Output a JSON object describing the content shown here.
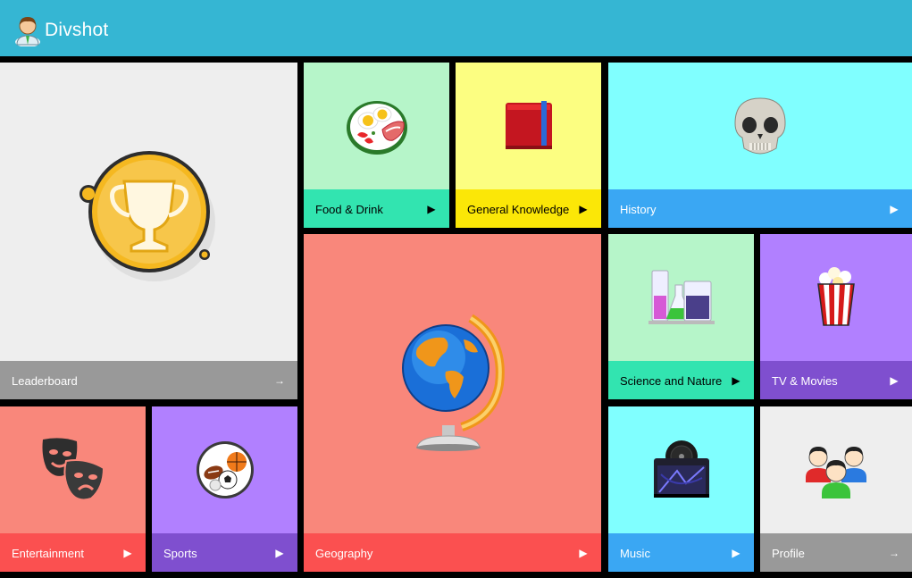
{
  "header": {
    "brand": "Divshot",
    "bg": "#35b6d3"
  },
  "tiles": {
    "leaderboard": {
      "label": "Leaderboard",
      "icon": "trophy-icon",
      "arrow": "→",
      "bg": "#eeeeee",
      "bar": "#999999"
    },
    "food": {
      "label": "Food & Drink",
      "icon": "food-plate-icon",
      "arrow": "▶",
      "bg": "#b6f5c9",
      "bar": "#32e4b0"
    },
    "general": {
      "label": "General Knowledge",
      "icon": "book-icon",
      "arrow": "▶",
      "bg": "#fcfe81",
      "bar": "#fbe707"
    },
    "history": {
      "label": "History",
      "icon": "skull-icon",
      "arrow": "▶",
      "bg": "#80ffff",
      "bar": "#3aa7f3"
    },
    "geography": {
      "label": "Geography",
      "icon": "globe-icon",
      "arrow": "▶",
      "bg": "#f9877b",
      "bar": "#fb5050"
    },
    "science": {
      "label": "Science and Nature",
      "icon": "lab-flasks-icon",
      "arrow": "▶",
      "bg": "#b6f5c9",
      "bar": "#32e4b0"
    },
    "tv": {
      "label": "TV & Movies",
      "icon": "popcorn-icon",
      "arrow": "▶",
      "bg": "#b180ff",
      "bar": "#7f4fcf"
    },
    "entertainment": {
      "label": "Entertainment",
      "icon": "theater-masks-icon",
      "arrow": "▶",
      "bg": "#f9877b",
      "bar": "#fb5050"
    },
    "sports": {
      "label": "Sports",
      "icon": "sports-balls-icon",
      "arrow": "▶",
      "bg": "#b180ff",
      "bar": "#7f4fcf"
    },
    "music": {
      "label": "Music",
      "icon": "music-record-icon",
      "arrow": "▶",
      "bg": "#80ffff",
      "bar": "#3aa7f3"
    },
    "profile": {
      "label": "Profile",
      "icon": "users-group-icon",
      "arrow": "→",
      "bg": "#eeeeee",
      "bar": "#999999"
    }
  }
}
